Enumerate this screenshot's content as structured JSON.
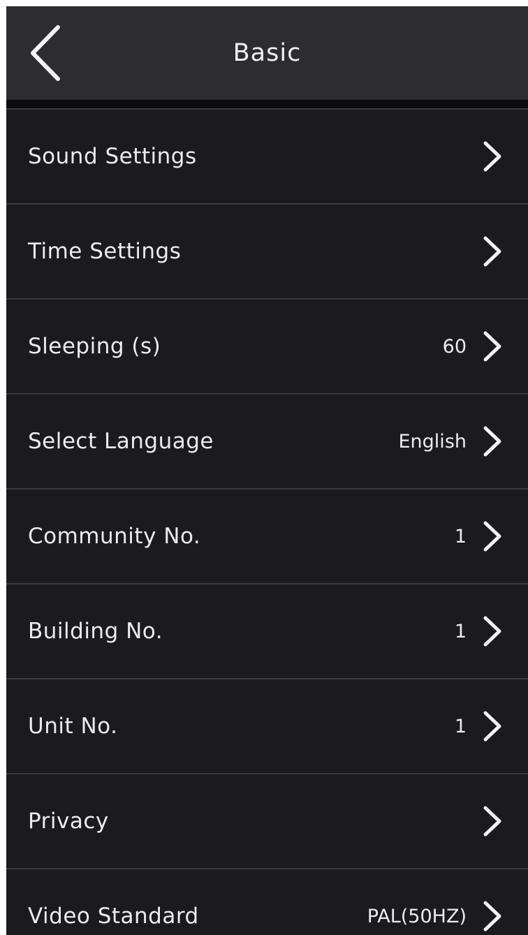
{
  "header": {
    "title": "Basic",
    "back_icon": "chevron-left-icon"
  },
  "colors": {
    "background": "#1b1b1e",
    "header_background": "#2c2c31",
    "divider": "#3a3a3f",
    "text": "#ececec"
  },
  "settings": {
    "items": [
      {
        "label": "Sound Settings",
        "value": ""
      },
      {
        "label": "Time Settings",
        "value": ""
      },
      {
        "label": "Sleeping (s)",
        "value": "60"
      },
      {
        "label": "Select Language",
        "value": "English"
      },
      {
        "label": "Community No.",
        "value": "1"
      },
      {
        "label": "Building No.",
        "value": "1"
      },
      {
        "label": "Unit No.",
        "value": "1"
      },
      {
        "label": "Privacy",
        "value": ""
      },
      {
        "label": "Video Standard",
        "value": "PAL(50HZ)"
      }
    ],
    "row_icon": "chevron-right-icon"
  }
}
